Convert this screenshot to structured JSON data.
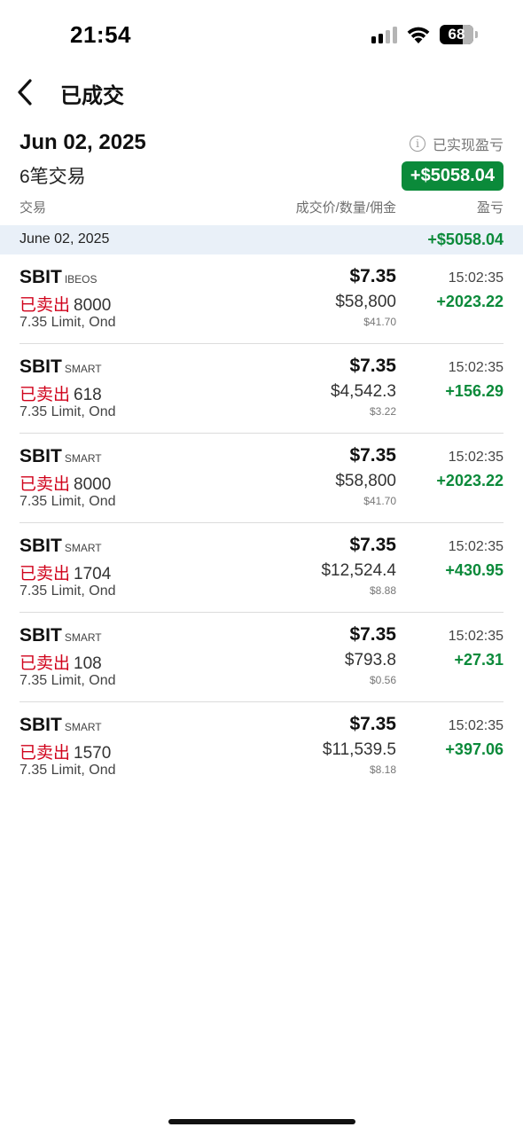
{
  "status_bar": {
    "time": "21:54",
    "battery": "68"
  },
  "nav": {
    "title": "已成交"
  },
  "summary": {
    "date": "Jun 02, 2025",
    "trade_count": "6笔交易",
    "realized_label": "已实现盈亏",
    "realized_value": "+$5058.04"
  },
  "columns": {
    "trade": "交易",
    "price_qty_comm": "成交价/数量/佣金",
    "pl": "盈亏"
  },
  "group": {
    "date": "June 02, 2025",
    "pl": "+$5058.04"
  },
  "trades": [
    {
      "symbol": "SBIT",
      "exchange": "IBEOS",
      "side": "已卖出",
      "qty": "8000",
      "order": "7.35 Limit, Ond",
      "price": "$7.35",
      "amount": "$58,800",
      "commission": "$41.70",
      "time": "15:02:35",
      "pl": "+2023.22"
    },
    {
      "symbol": "SBIT",
      "exchange": "SMART",
      "side": "已卖出",
      "qty": "618",
      "order": "7.35 Limit, Ond",
      "price": "$7.35",
      "amount": "$4,542.3",
      "commission": "$3.22",
      "time": "15:02:35",
      "pl": "+156.29"
    },
    {
      "symbol": "SBIT",
      "exchange": "SMART",
      "side": "已卖出",
      "qty": "8000",
      "order": "7.35 Limit, Ond",
      "price": "$7.35",
      "amount": "$58,800",
      "commission": "$41.70",
      "time": "15:02:35",
      "pl": "+2023.22"
    },
    {
      "symbol": "SBIT",
      "exchange": "SMART",
      "side": "已卖出",
      "qty": "1704",
      "order": "7.35 Limit, Ond",
      "price": "$7.35",
      "amount": "$12,524.4",
      "commission": "$8.88",
      "time": "15:02:35",
      "pl": "+430.95"
    },
    {
      "symbol": "SBIT",
      "exchange": "SMART",
      "side": "已卖出",
      "qty": "108",
      "order": "7.35 Limit, Ond",
      "price": "$7.35",
      "amount": "$793.8",
      "commission": "$0.56",
      "time": "15:02:35",
      "pl": "+27.31"
    },
    {
      "symbol": "SBIT",
      "exchange": "SMART",
      "side": "已卖出",
      "qty": "1570",
      "order": "7.35 Limit, Ond",
      "price": "$7.35",
      "amount": "$11,539.5",
      "commission": "$8.18",
      "time": "15:02:35",
      "pl": "+397.06"
    }
  ],
  "colors": {
    "profit_green": "#0b8a3a",
    "sell_red": "#d0021b",
    "group_bg": "#e9f0f8"
  }
}
